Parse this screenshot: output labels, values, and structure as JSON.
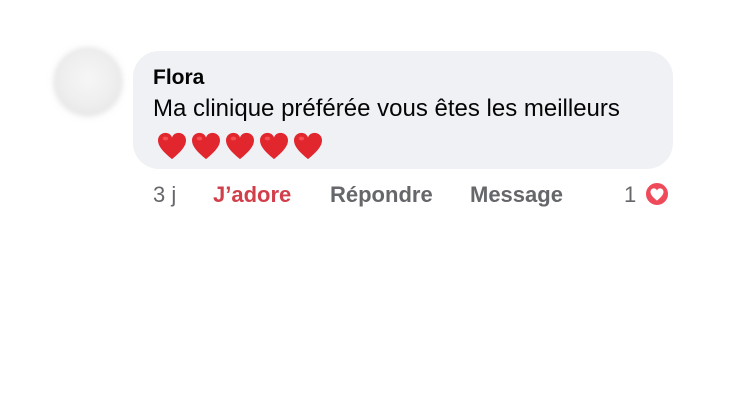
{
  "comment": {
    "author": "Flora",
    "text": "Ma clinique préférée vous êtes les meilleurs",
    "emoji_icons": [
      "heart-icon",
      "heart-icon",
      "heart-icon",
      "heart-icon",
      "heart-icon"
    ]
  },
  "actions": {
    "time": "3 j",
    "like_label": "J’adore",
    "reply_label": "Répondre",
    "message_label": "Message"
  },
  "reactions": {
    "count": "1",
    "icon": "love-reaction-icon"
  },
  "colors": {
    "bubble_bg": "#f0f1f5",
    "like_active": "#d13f4b",
    "action_gray": "#65676b",
    "heart_red": "#e2262e",
    "reaction_red": "#ef4a5a"
  }
}
